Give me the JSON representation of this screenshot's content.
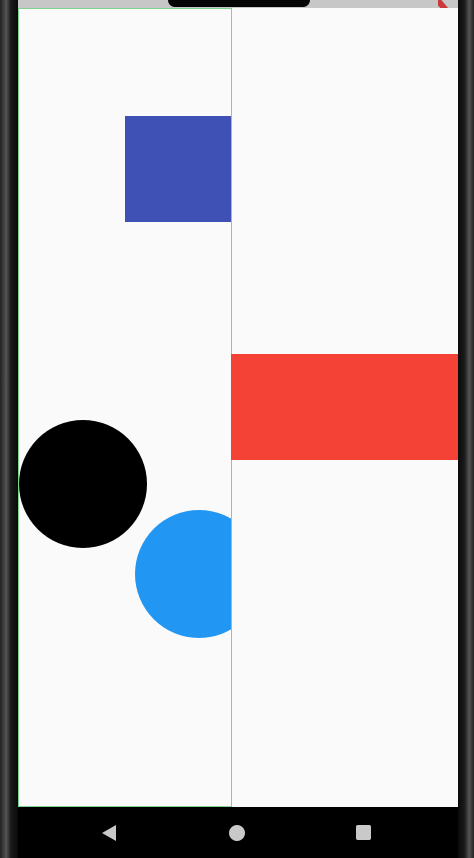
{
  "colors": {
    "screen_background": "#fafafa",
    "pane_border": "#7ed38e",
    "blue_square": "#3f51b5",
    "red_rectangle": "#f44336",
    "black_circle": "#000000",
    "blue_circle": "#2196f3",
    "nav_bar": "#000000",
    "nav_icon": "#c9c9c9"
  },
  "nav_bar": {
    "back_icon": "back-triangle-icon",
    "home_icon": "home-circle-icon",
    "recents_icon": "recents-square-icon"
  }
}
